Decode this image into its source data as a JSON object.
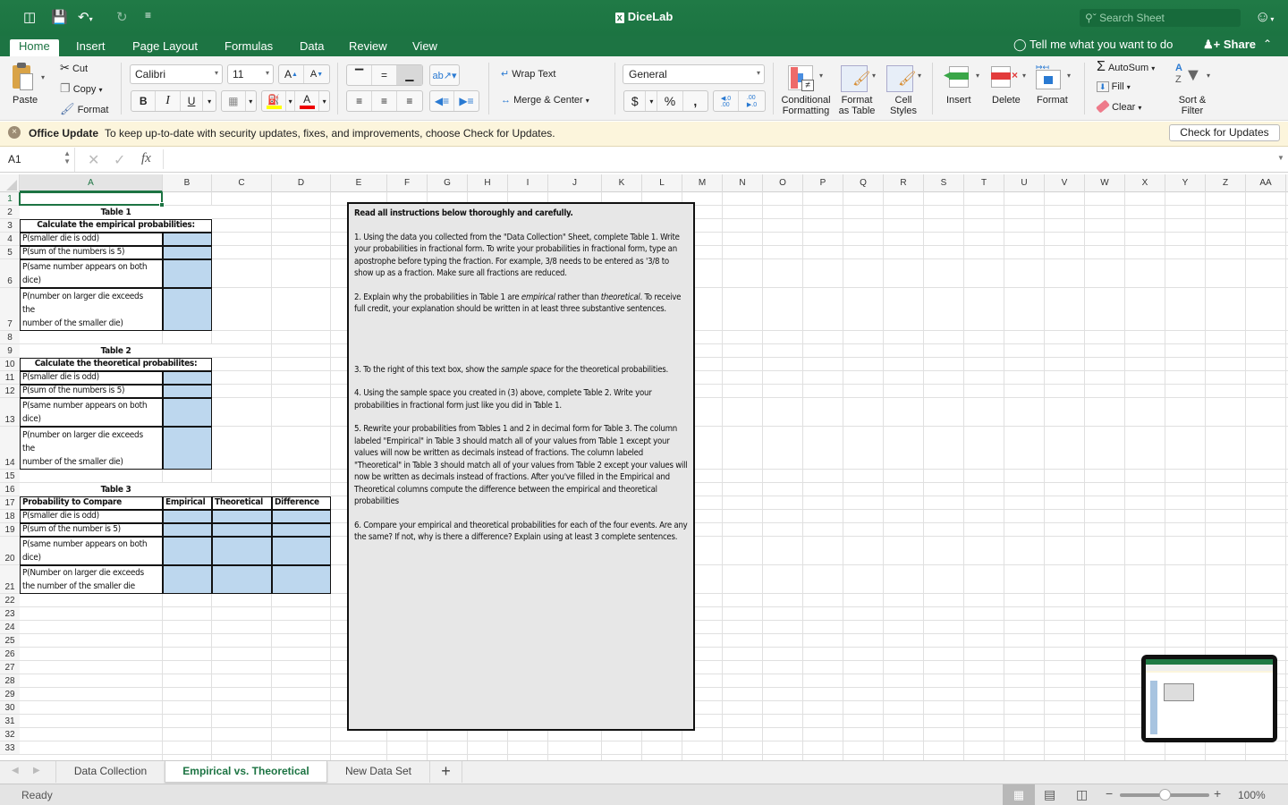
{
  "app": {
    "title": "DiceLab",
    "search_placeholder": "Search Sheet"
  },
  "ribbon_tabs": [
    "Home",
    "Insert",
    "Page Layout",
    "Formulas",
    "Data",
    "Review",
    "View"
  ],
  "active_tab": "Home",
  "tell_me": "Tell me what you want to do",
  "share": "Share",
  "ribbon": {
    "paste": "Paste",
    "cut": "Cut",
    "copy": "Copy",
    "format_painter": "Format",
    "font_name": "Calibri",
    "font_size": "11",
    "bold": "B",
    "italic": "I",
    "underline": "U",
    "wrap_text": "Wrap Text",
    "merge_center": "Merge & Center",
    "number_format": "General",
    "currency": "$",
    "percent": "%",
    "comma": ",",
    "increase_decimal": "←.0 .00",
    "decrease_decimal": ".00 →.0",
    "conditional_formatting": [
      "Conditional",
      "Formatting"
    ],
    "format_as_table": [
      "Format",
      "as Table"
    ],
    "cell_styles": [
      "Cell",
      "Styles"
    ],
    "insert": "Insert",
    "delete": "Delete",
    "format": "Format",
    "autosum": "AutoSum",
    "fill": "Fill",
    "clear": "Clear",
    "sort_filter": [
      "Sort &",
      "Filter"
    ]
  },
  "message_bar": {
    "title": "Office Update",
    "text": "To keep up-to-date with security updates, fixes, and improvements, choose Check for Updates.",
    "button": "Check for Updates"
  },
  "formula_bar": {
    "name_box": "A1",
    "fx": "fx",
    "value": ""
  },
  "columns": [
    "A",
    "B",
    "C",
    "D",
    "E",
    "F",
    "G",
    "H",
    "I",
    "J",
    "K",
    "L",
    "M",
    "N",
    "O",
    "P",
    "Q",
    "R",
    "S",
    "T",
    "U",
    "V",
    "W",
    "X",
    "Y",
    "Z",
    "AA"
  ],
  "rows": [
    "1",
    "2",
    "3",
    "4",
    "5",
    "6",
    "7",
    "8",
    "9",
    "10",
    "11",
    "12",
    "13",
    "14",
    "15",
    "16",
    "17",
    "18",
    "19",
    "20",
    "21",
    "22",
    "23",
    "24",
    "25",
    "26",
    "27",
    "28",
    "29",
    "30",
    "31",
    "32",
    "33"
  ],
  "table1": {
    "title": "Table 1",
    "header": "Calculate the empirical probabilities:",
    "items": [
      "P(smaller die is odd)",
      "P(sum of the numbers is 5)",
      "P(same number appears on both\ndice)",
      "P(number on larger die exceeds\nthe\nnumber of the smaller die)"
    ]
  },
  "table2": {
    "title": "Table 2",
    "header": "Calculate the theoretical probabilites:",
    "items": [
      "P(smaller die is odd)",
      "P(sum of the numbers is 5)",
      "P(same number appears on both\ndice)",
      "P(number on larger die exceeds\nthe\nnumber of the smaller die)"
    ]
  },
  "table3": {
    "title": "Table 3",
    "headers": [
      "Probability to Compare",
      "Empirical",
      "Theoretical",
      "Difference"
    ],
    "items": [
      "P(smaller die is odd)",
      "P(sum of the number is 5)",
      "P(same number appears on both\ndice)",
      "P(Number on larger die exceeds\nthe number of the smaller die"
    ]
  },
  "instructions": {
    "heading": "Read all instructions below thoroughly and carefully.",
    "p1": "1. Using the data you collected from the \"Data Collection\" Sheet, complete Table 1. Write your probabilities in fractional form. To write your probabilities in fractional form, type an apostrophe before typing the fraction. For example, 3/8 needs to be entered as '3/8 to show up as a fraction. Make sure all fractions are reduced.",
    "p2a": "2. Explain why the probabilities in Table 1 are ",
    "p2b": "empirical",
    "p2c": " rather than ",
    "p2d": "theoretical",
    "p2e": ". To receive full credit, your explanation should be written in at least three substantive sentences.",
    "p3a": "3. To the right of this text box, show the ",
    "p3b": "sample space",
    "p3c": " for the theoretical probabilities.",
    "p4": "4. Using the sample space you created in (3) above, complete Table 2. Write your probabilities in fractional form just like you did in Table 1.",
    "p5": "5. Rewrite your probabilities from Tables 1 and 2 in decimal form for Table 3. The column labeled \"Empirical\" in Table 3 should match all of your values from Table 1 except your values will now be written as decimals instead of fractions. The column labeled \"Theoretical\" in Table 3 should match all of your values from Table 2 except your values will now be written as decimals instead of fractions. After you've filled in the Empirical and Theoretical columns compute the difference between the empirical and theoretical probabilities",
    "p6": "6. Compare your empirical and theoretical probabilities for each of the four events. Are any the same? If not, why is there a difference? Explain using at least 3 complete sentences."
  },
  "sheet_tabs": [
    "Data Collection",
    "Empirical vs. Theoretical",
    "New Data Set"
  ],
  "active_sheet": "Empirical vs. Theoretical",
  "status": {
    "text": "Ready",
    "zoom": "100%",
    "zoom_fraction": 0.5
  },
  "colors": {
    "brand_green": "#1f7a45",
    "input_fill": "#bdd7ee",
    "textbox_fill": "#e7e7e7",
    "message_bar": "#fcf5dc"
  }
}
